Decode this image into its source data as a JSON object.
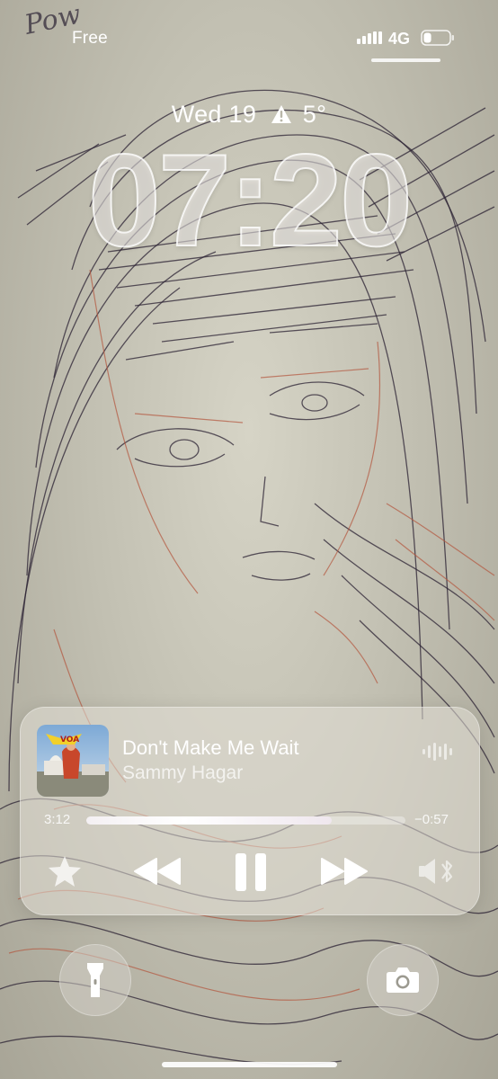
{
  "status_bar": {
    "carrier": "Free",
    "network": "4G",
    "signal_bars": 4,
    "battery_level": 0.3,
    "icons": [
      "signal-icon",
      "battery-icon"
    ]
  },
  "lock_screen": {
    "date": "Wed 19",
    "weather_icon": "warning-icon",
    "temperature": "5°",
    "time": "07:20"
  },
  "now_playing": {
    "title": "Don't Make Me Wait",
    "artist": "Sammy Hagar",
    "artwork_text": "VOA",
    "elapsed": "3:12",
    "remaining": "−0:57",
    "progress": 0.77,
    "controls": {
      "favorite": "star-icon",
      "previous": "rewind-icon",
      "play_pause": "pause-icon",
      "next": "fast-forward-icon",
      "output": "bluetooth-speaker-icon"
    },
    "audio_indicator": "waveform-icon"
  },
  "quick_actions": {
    "left": "flashlight-icon",
    "right": "camera-icon"
  },
  "wallpaper": {
    "description_colors": {
      "paper": "#c9c7b9",
      "ink_dark": "#2a2030",
      "ink_red": "#b0553a"
    }
  }
}
